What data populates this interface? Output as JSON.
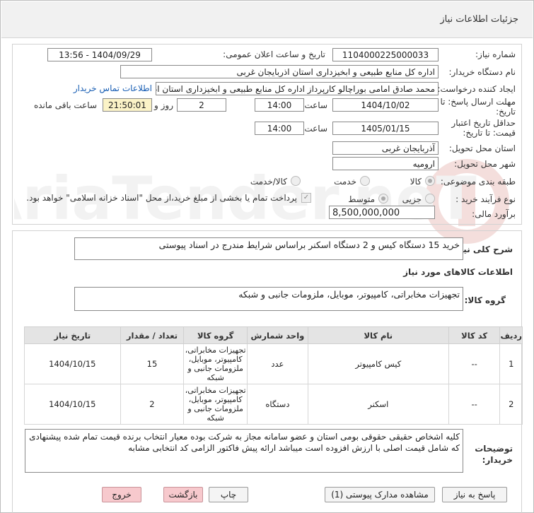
{
  "header": {
    "title": "جزئیات اطلاعات نیاز"
  },
  "form": {
    "need_number_label": "شماره نیاز:",
    "need_number": "1104000225000033",
    "announce_label": "تاریخ و ساعت اعلان عمومی:",
    "announce_value": "1404/09/29 - 13:56",
    "buyer_org_label": "نام دستگاه خریدار:",
    "buyer_org": "اداره کل منابع طبیعی و ابخیزداری استان اذربایجان غربی",
    "creator_label": "ایجاد کننده درخواست:",
    "creator": "محمد صادق امامی بوراچالو کارپرداز اداره کل منابع طبیعی و ابخیزداری استان اذربایجان غربی",
    "contact_link": "اطلاعات تماس خریدار",
    "deadline_label_1": "مهلت ارسال پاسخ: تا",
    "deadline_label_2": "تاریخ:",
    "deadline_date": "1404/10/02",
    "time_label": "ساعت",
    "deadline_time": "14:00",
    "days_value": "2",
    "days_label": "روز و",
    "remaining_value": "21:50:01",
    "remaining_label": "ساعت باقی مانده",
    "validity_label_1": "حداقل تاریخ اعتبار",
    "validity_label_2": "قیمت: تا تاریخ:",
    "validity_date": "1405/01/15",
    "validity_time": "14:00",
    "province_label": "استان محل تحویل:",
    "province": "آذربایجان غربی",
    "city_label": "شهر محل تحویل:",
    "city": "ارومیه",
    "category_label": "طبقه بندی موضوعی:",
    "category_options": [
      "کالا",
      "خدمت",
      "کالا/خدمت"
    ],
    "process_label": "نوع فرآیند خرید :",
    "process_options": [
      "جزیی",
      "متوسط"
    ],
    "payment_note": "پرداخت تمام یا بخشی از مبلغ خرید،از محل \"اسناد خزانه اسلامی\" خواهد بود.",
    "estimate_label": "برآورد مالی:",
    "estimate": "8,500,000,000"
  },
  "watermark": {
    "text": "AriaTender.neT"
  },
  "summary": {
    "label": "شرح کلی نیاز:",
    "text": "خرید 15 دستگاه کیس و 2 دستگاه اسکنر براساس شرایط مندرج در اسناد پیوستی"
  },
  "goods": {
    "section_title": "اطلاعات کالاهای مورد نیاز",
    "group_label": "گروه کالا:",
    "group_value": "تجهیزات مخابراتی، کامپیوتر، موبایل، ملزومات جانبی و شبکه",
    "columns": [
      "ردیف",
      "کد کالا",
      "نام کالا",
      "واحد شمارش",
      "گروه کالا",
      "تعداد / مقدار",
      "تاریخ نیاز"
    ],
    "rows": [
      {
        "idx": "1",
        "code": "--",
        "name": "کیس کامپیوتر",
        "unit": "عدد",
        "group": "تجهیزات مخابراتی، کامپیوتر، موبایل، ملزومات جانبی و شبکه",
        "qty": "15",
        "date": "1404/10/15"
      },
      {
        "idx": "2",
        "code": "--",
        "name": "اسکنر",
        "unit": "دستگاه",
        "group": "تجهیزات مخابراتی، کامپیوتر، موبایل، ملزومات جانبی و شبکه",
        "qty": "2",
        "date": "1404/10/15"
      }
    ]
  },
  "notes": {
    "label_1": "توضیحات",
    "label_2": "خریدار:",
    "text": "کلیه اشخاص حقیقی حقوقی بومی استان و عضو سامانه مجاز به شرکت بوده معیار انتخاب برنده قیمت تمام شده پیشنهادی که شامل قیمت اصلی با ارزش افزوده است میباشد ارائه پیش فاکتور الزامی کد انتخابی مشابه"
  },
  "buttons": {
    "reply": "پاسخ به نیاز",
    "attachments": "مشاهده مدارک پیوستی (1)",
    "print": "چاپ",
    "back": "بازگشت",
    "exit": "خروج"
  }
}
